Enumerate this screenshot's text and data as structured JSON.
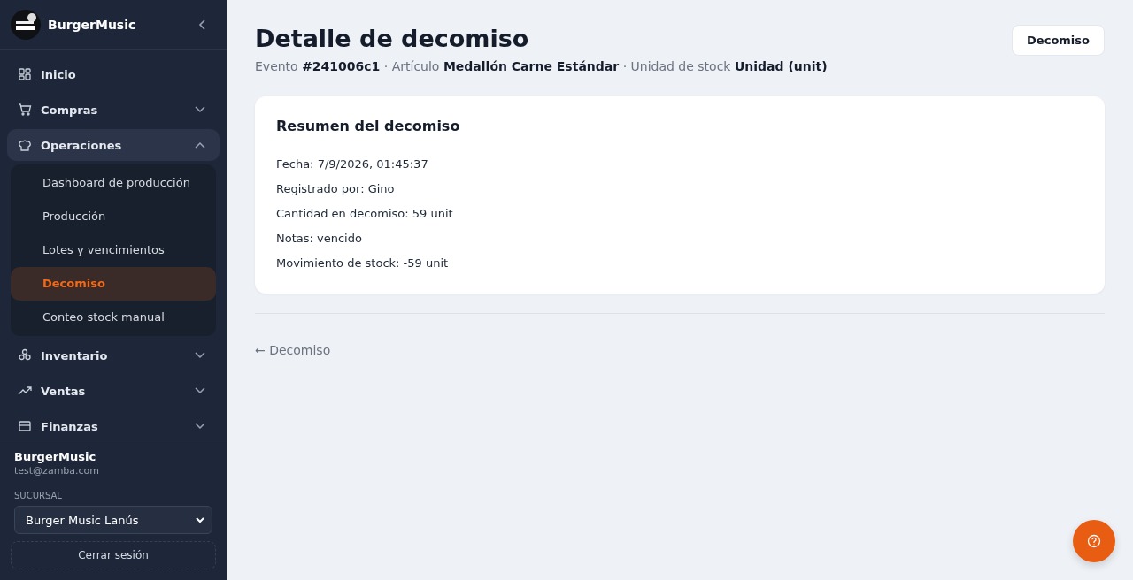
{
  "sidebar": {
    "brand": "BurgerMusic",
    "nav": [
      {
        "label": "Inicio"
      },
      {
        "label": "Compras",
        "expanded": false
      },
      {
        "label": "Operaciones",
        "expanded": true,
        "children": [
          {
            "label": "Dashboard de producción",
            "selected": false
          },
          {
            "label": "Producción",
            "selected": false
          },
          {
            "label": "Lotes y vencimientos",
            "selected": false
          },
          {
            "label": "Decomiso",
            "selected": true
          },
          {
            "label": "Conteo stock manual",
            "selected": false
          }
        ]
      },
      {
        "label": "Inventario",
        "expanded": false
      },
      {
        "label": "Ventas",
        "expanded": false
      },
      {
        "label": "Finanzas",
        "expanded": false
      }
    ],
    "user": {
      "name": "BurgerMusic",
      "email": "test@zamba.com"
    },
    "branch_label": "SUCURSAL",
    "branch": "Burger Music Lanús",
    "logout": "Cerrar sesión"
  },
  "header": {
    "title": "Detalle de decomiso",
    "subtitle": "Evento **#241006c1** · Artículo **Medallón Carne Estándar** · Unidad de stock **Unidad (unit)**",
    "action": "Decomiso"
  },
  "card": {
    "title": "Resumen del decomiso",
    "lines": [
      "Fecha: 7/9/2026, 01:45:37",
      "Registrado por: Gino",
      "Cantidad en decomiso: 59 unit",
      "Notas: vencido",
      "Movimiento de stock: -59 unit"
    ]
  },
  "back_link": "← Decomiso"
}
